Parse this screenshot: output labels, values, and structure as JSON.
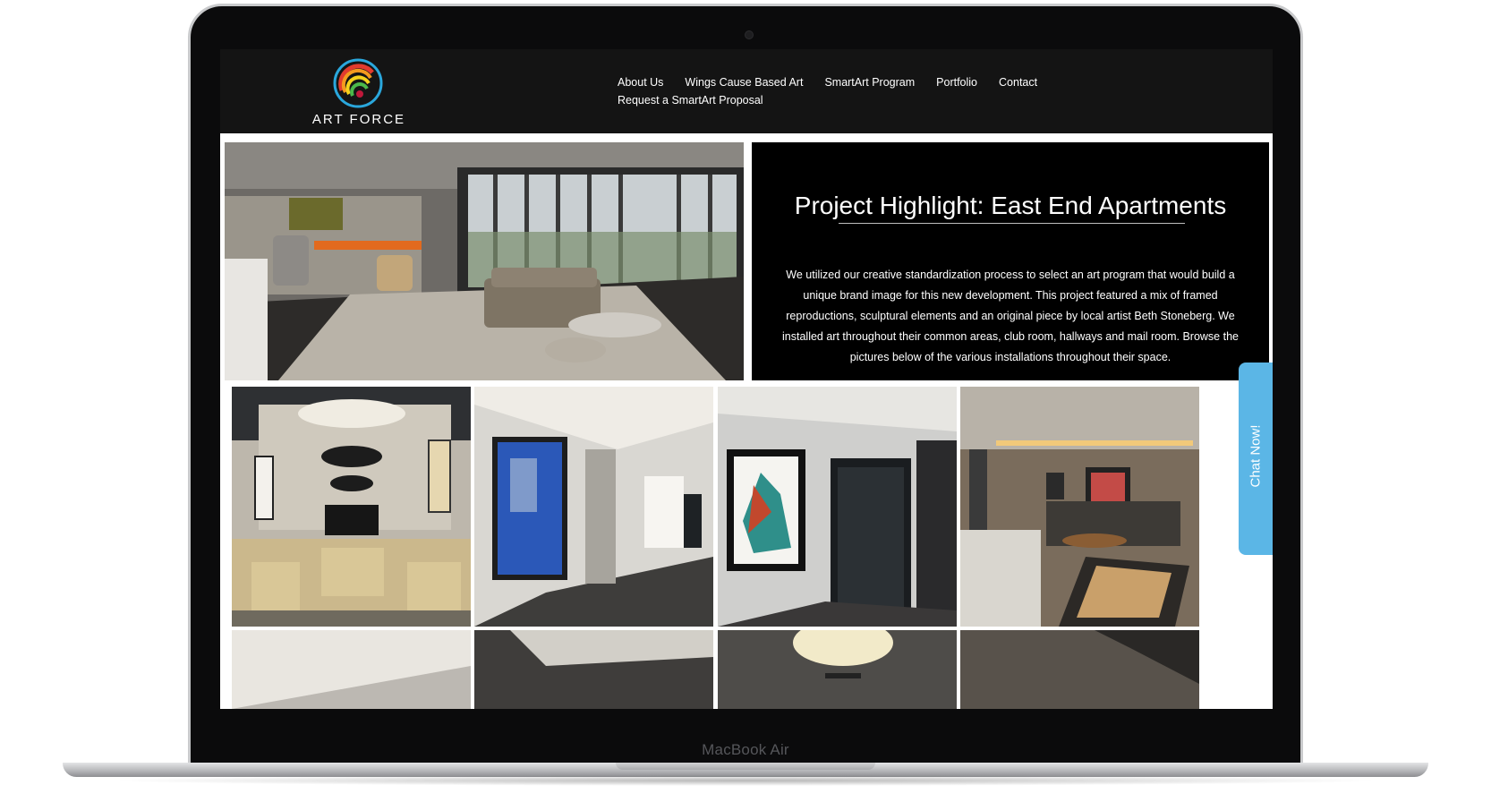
{
  "device": {
    "label": "MacBook Air"
  },
  "site": {
    "logo_text": "ART FORCE",
    "nav": [
      {
        "label": "About Us"
      },
      {
        "label": "Wings Cause Based Art"
      },
      {
        "label": "SmartArt Program"
      },
      {
        "label": "Portfolio"
      },
      {
        "label": "Contact"
      },
      {
        "label": "Request a SmartArt Proposal"
      }
    ]
  },
  "hero": {
    "title": "Project Highlight: East End Apartments",
    "body": "We utilized our creative standardization process to select an art program that would build a unique brand image for this new  development. This project featured a mix of framed reproductions, sculptural elements and an original piece by local artist Beth Stoneberg. We installed art throughout their common areas, club room, hallways and mail room. Browse the pictures below of the various installations throughout their space."
  },
  "chat": {
    "label": "Chat Now!"
  },
  "colors": {
    "header_bg": "#141414",
    "panel_bg": "#000000",
    "chat_accent": "#5bb6e6"
  }
}
